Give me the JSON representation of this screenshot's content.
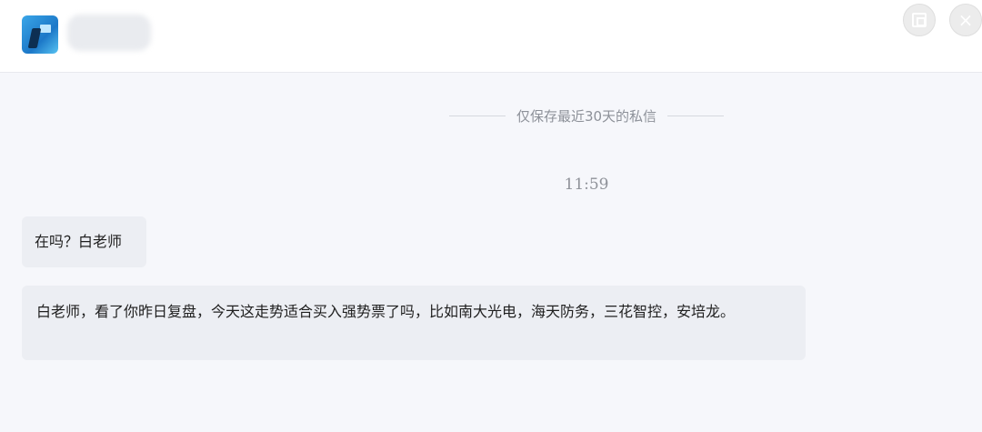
{
  "header": {
    "avatar_icon": "app-avatar-icon",
    "username": "",
    "screenshot_icon": "screenshot-icon",
    "close_icon": "close-icon",
    "close_glyph": "×"
  },
  "notice": {
    "text": "仅保存最近30天的私信"
  },
  "timestamp": "11:59",
  "messages": [
    {
      "text": "在吗？白老师"
    },
    {
      "text": "白老师，看了你昨日复盘，今天这走势适合买入强势票了吗，比如南大光电，海天防务，三花智控，安培龙。"
    }
  ],
  "colors": {
    "background": "#f6f7fb",
    "bubble": "#eceef3",
    "muted_text": "#8d9199"
  }
}
